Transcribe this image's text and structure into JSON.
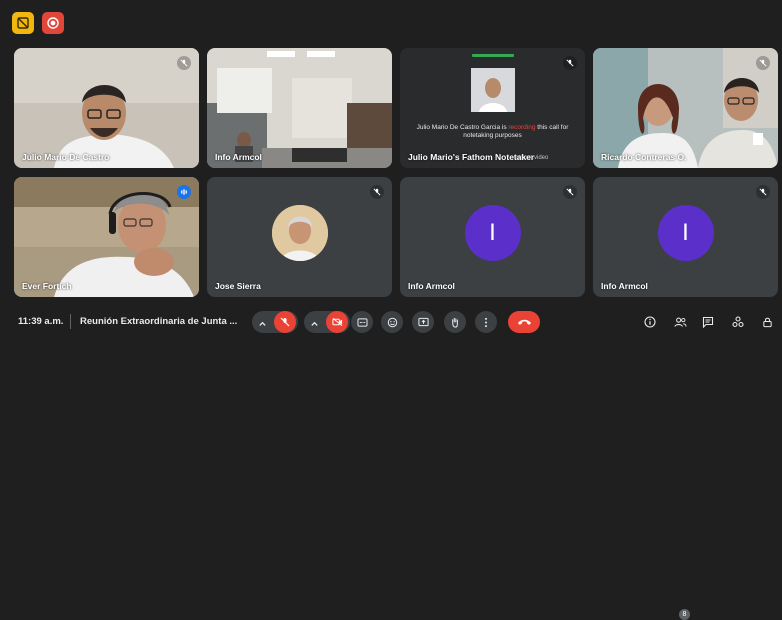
{
  "top_badges": [
    {
      "name": "notetaker-badge-icon",
      "color": "#f2b70f"
    },
    {
      "name": "recording-badge-icon",
      "color": "#e0463a"
    }
  ],
  "tiles": [
    {
      "name": "Julio Mario De Castro",
      "mic": "muted"
    },
    {
      "name": "Info Armcol",
      "mic": "none"
    },
    {
      "name": "Julio Mario's Fathom Notetaker",
      "mic": "muted",
      "card_text_pre": "Julio Mario De Castro Garcia is ",
      "card_text_rec": "recording",
      "card_text_post": " this call for notetaking purposes",
      "card_footer": "fathom.video"
    },
    {
      "name": "Ricardo Contreras O.",
      "mic": "muted"
    },
    {
      "name": "Ever Fortich",
      "mic": "speaking"
    },
    {
      "name": "Jose Sierra",
      "mic": "muted"
    },
    {
      "name": "Info Armcol",
      "mic": "muted",
      "initial": "I"
    },
    {
      "name": "Info Armcol",
      "mic": "muted",
      "initial": "I"
    }
  ],
  "bottom": {
    "time": "11:39 a.m.",
    "title": "Reunión Extraordinaria de Junta ...",
    "participant_count": "8"
  },
  "controls": [
    "mic-off-icon",
    "camera-off-icon",
    "captions-icon",
    "emoji-icon",
    "present-icon",
    "raise-hand-icon",
    "more-icon",
    "end-call-icon"
  ],
  "right_icons": [
    "info-icon",
    "people-icon",
    "chat-icon",
    "activities-icon",
    "lock-icon"
  ]
}
